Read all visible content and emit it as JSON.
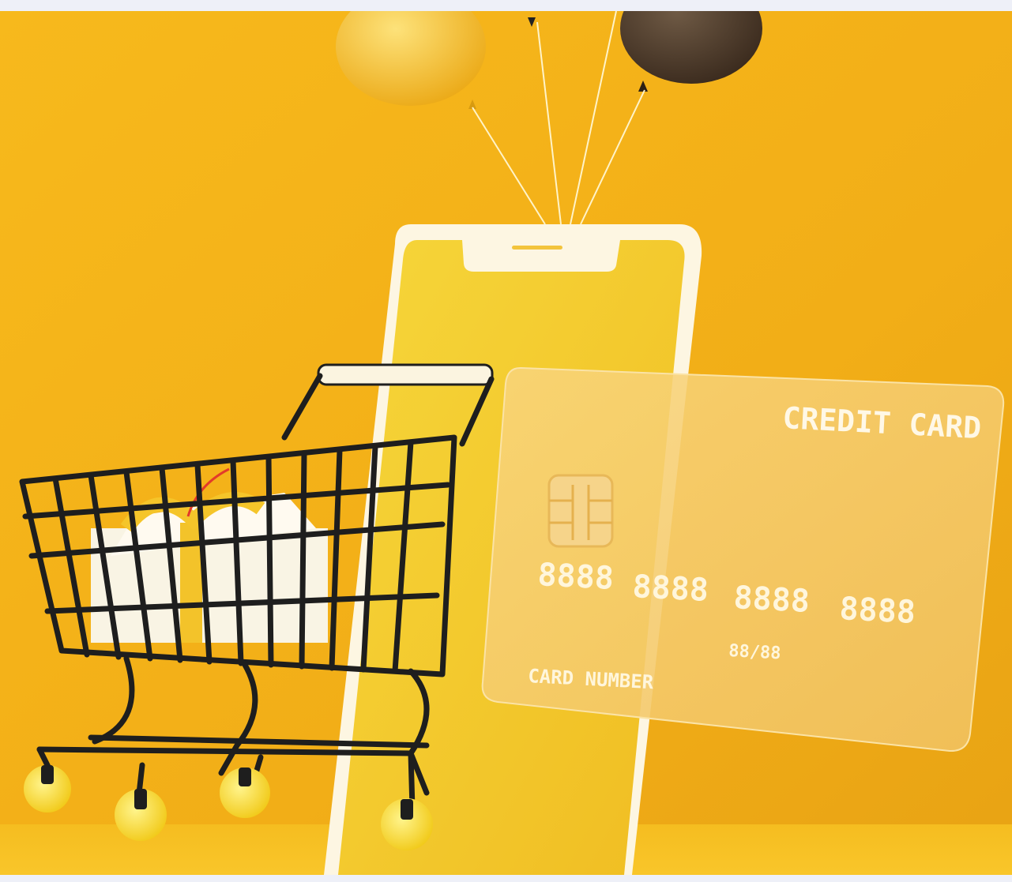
{
  "image": {
    "subject": "shopping-cart-phone-credit-card-illustration",
    "colors": {
      "background": "#f0b21c",
      "phone_body": "#fbf3dc",
      "phone_screen": "#f4cc2a",
      "cart_wire": "#1f1f1f",
      "balloon_yellow": "#f2bd1e",
      "balloon_brown": "#4e3b2a",
      "card": "#f6c862"
    }
  },
  "card": {
    "title": "CREDIT CARD",
    "number_groups": [
      "8888",
      "8888",
      "8888",
      "8888"
    ],
    "expiry": "88/88",
    "label": "CARD NUMBER"
  }
}
